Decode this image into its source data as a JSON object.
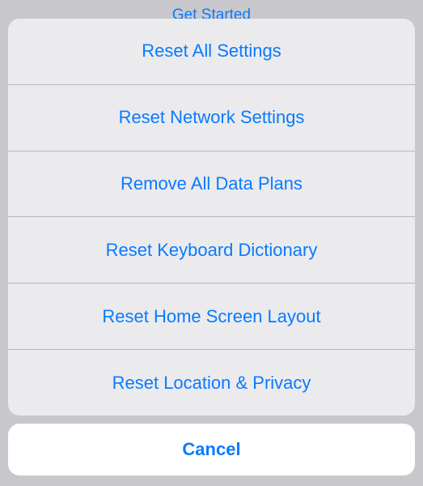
{
  "backdrop": {
    "partial_text": "Get Started"
  },
  "actionSheet": {
    "options": [
      {
        "label": "Reset All Settings"
      },
      {
        "label": "Reset Network Settings"
      },
      {
        "label": "Remove All Data Plans"
      },
      {
        "label": "Reset Keyboard Dictionary"
      },
      {
        "label": "Reset Home Screen Layout"
      },
      {
        "label": "Reset Location & Privacy"
      }
    ],
    "cancel_label": "Cancel"
  },
  "colors": {
    "accent": "#0a7aff",
    "sheet_bg": "#ecececf5",
    "cancel_bg": "#ffffff",
    "page_bg": "#c8c8cc"
  }
}
